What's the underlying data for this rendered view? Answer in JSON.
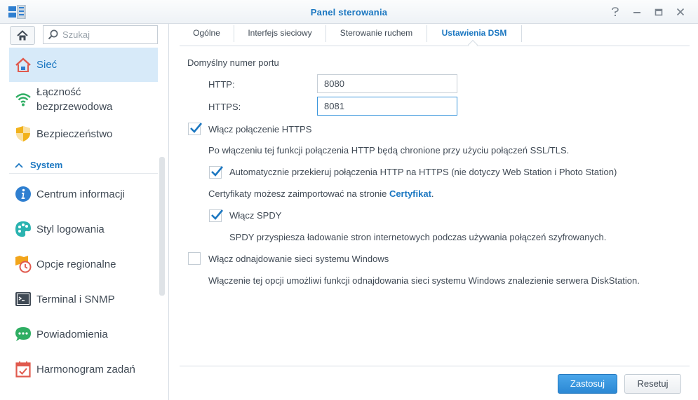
{
  "window": {
    "title": "Panel sterowania",
    "controls": [
      "help-icon",
      "minimize-icon",
      "maximize-icon",
      "close-icon"
    ]
  },
  "sidebar": {
    "search_placeholder": "Szukaj",
    "items": [
      {
        "label": "Sieć",
        "icon": "network-home-icon",
        "active": true
      },
      {
        "label_line1": "Łączność",
        "label_line2": "bezprzewodowa",
        "icon": "wifi-icon"
      },
      {
        "label": "Bezpieczeństwo",
        "icon": "shield-icon"
      }
    ],
    "section": "System",
    "system_items": [
      {
        "label": "Centrum informacji",
        "icon": "info-icon"
      },
      {
        "label": "Styl logowania",
        "icon": "palette-icon"
      },
      {
        "label": "Opcje regionalne",
        "icon": "regional-clock-icon"
      },
      {
        "label": "Terminal i SNMP",
        "icon": "terminal-icon"
      },
      {
        "label": "Powiadomienia",
        "icon": "chat-bubble-icon"
      },
      {
        "label": "Harmonogram zadań",
        "icon": "calendar-icon"
      }
    ]
  },
  "tabs": [
    {
      "label": "Ogólne"
    },
    {
      "label": "Interfejs sieciowy"
    },
    {
      "label": "Sterowanie ruchem"
    },
    {
      "label": "Ustawienia DSM",
      "active": true
    }
  ],
  "settings": {
    "port_heading": "Domyślny numer portu",
    "http_label": "HTTP:",
    "http_value": "8080",
    "https_label": "HTTPS:",
    "https_value": "8081",
    "enable_https": {
      "label": "Włącz połączenie HTTPS",
      "checked": true
    },
    "https_desc": "Po włączeniu tej funkcji połączenia HTTP będą chronione przy użyciu połączeń SSL/TLS.",
    "auto_redirect": {
      "label": "Automatycznie przekieruj połączenia HTTP na HTTPS (nie dotyczy Web Station i Photo Station)",
      "checked": true
    },
    "cert_text": "Certyfikaty możesz zaimportować na stronie ",
    "cert_link": "Certyfikat",
    "cert_tail": ".",
    "enable_spdy": {
      "label": "Włącz SPDY",
      "checked": true
    },
    "spdy_desc": "SPDY przyspiesza ładowanie stron internetowych podczas używania połączeń szyfrowanych.",
    "windows_discovery": {
      "label": "Włącz odnajdowanie sieci systemu Windows",
      "checked": false
    },
    "windows_desc": "Włączenie tej opcji umożliwi funkcji odnajdowania sieci systemu Windows znalezienie serwera DiskStation."
  },
  "footer": {
    "apply_label": "Zastosuj",
    "reset_label": "Resetuj"
  },
  "colors": {
    "accent": "#1b77c1",
    "active_bg": "#d7eaf9",
    "checkmark": "#1b77c1",
    "primary_button": "#2b88d4"
  }
}
